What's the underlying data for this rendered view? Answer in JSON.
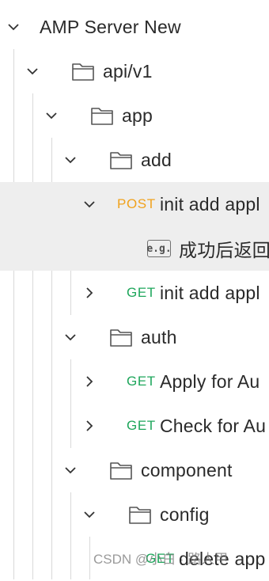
{
  "tree": {
    "root": "AMP Server New",
    "folder_api": "api/v1",
    "folder_app": "app",
    "folder_add": "add",
    "req1_method": "POST",
    "req1_name": "init add appl",
    "example_badge": "e.g.",
    "example_name": "成功后返回",
    "req2_method": "GET",
    "req2_name": "init add appl",
    "folder_auth": "auth",
    "req3_method": "GET",
    "req3_name": "Apply for Au",
    "req4_method": "GET",
    "req4_name": "Check for Au",
    "folder_component": "component",
    "folder_config": "config",
    "req5_method": "GET",
    "req5_name": "delete app"
  },
  "watermark": "CSDN @小白 · 路人甲",
  "colors": {
    "get": "#1ea65b",
    "post": "#f0a21d",
    "selected_row": "#eeeeee"
  }
}
